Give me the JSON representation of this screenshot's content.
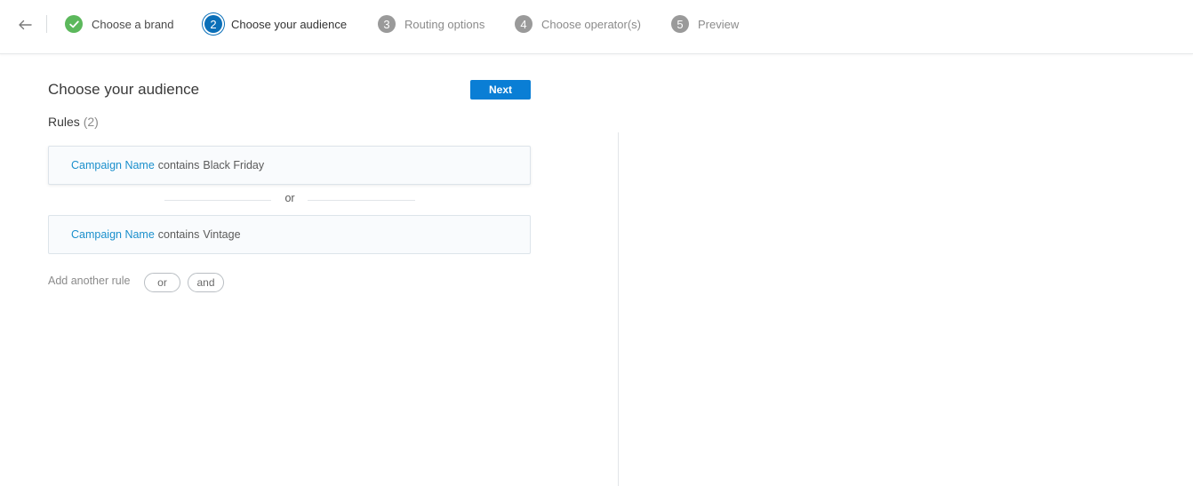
{
  "steps": [
    {
      "number": "1",
      "label": "Choose a brand",
      "state": "done"
    },
    {
      "number": "2",
      "label": "Choose your audience",
      "state": "active"
    },
    {
      "number": "3",
      "label": "Routing options",
      "state": "pending"
    },
    {
      "number": "4",
      "label": "Choose operator(s)",
      "state": "pending"
    },
    {
      "number": "5",
      "label": "Preview",
      "state": "pending"
    }
  ],
  "icons": {
    "back": "arrow-left-icon",
    "done": "checkmark-icon"
  },
  "colors": {
    "done": "#5cb85c",
    "active": "#0a6fb8",
    "pending": "#9a9a9a",
    "primary_button": "#0a7ed5",
    "rule_field": "#1a8fcc"
  },
  "main": {
    "title": "Choose your audience",
    "next_label": "Next",
    "rules_label": "Rules",
    "rules_count": "(2)",
    "rules": [
      {
        "field": "Campaign Name",
        "operator": "contains",
        "value": "Black Friday"
      },
      {
        "field": "Campaign Name",
        "operator": "contains",
        "value": "Vintage"
      }
    ],
    "separator": "or",
    "add_rule_label": "Add another rule",
    "or_button": "or",
    "and_button": "and"
  }
}
